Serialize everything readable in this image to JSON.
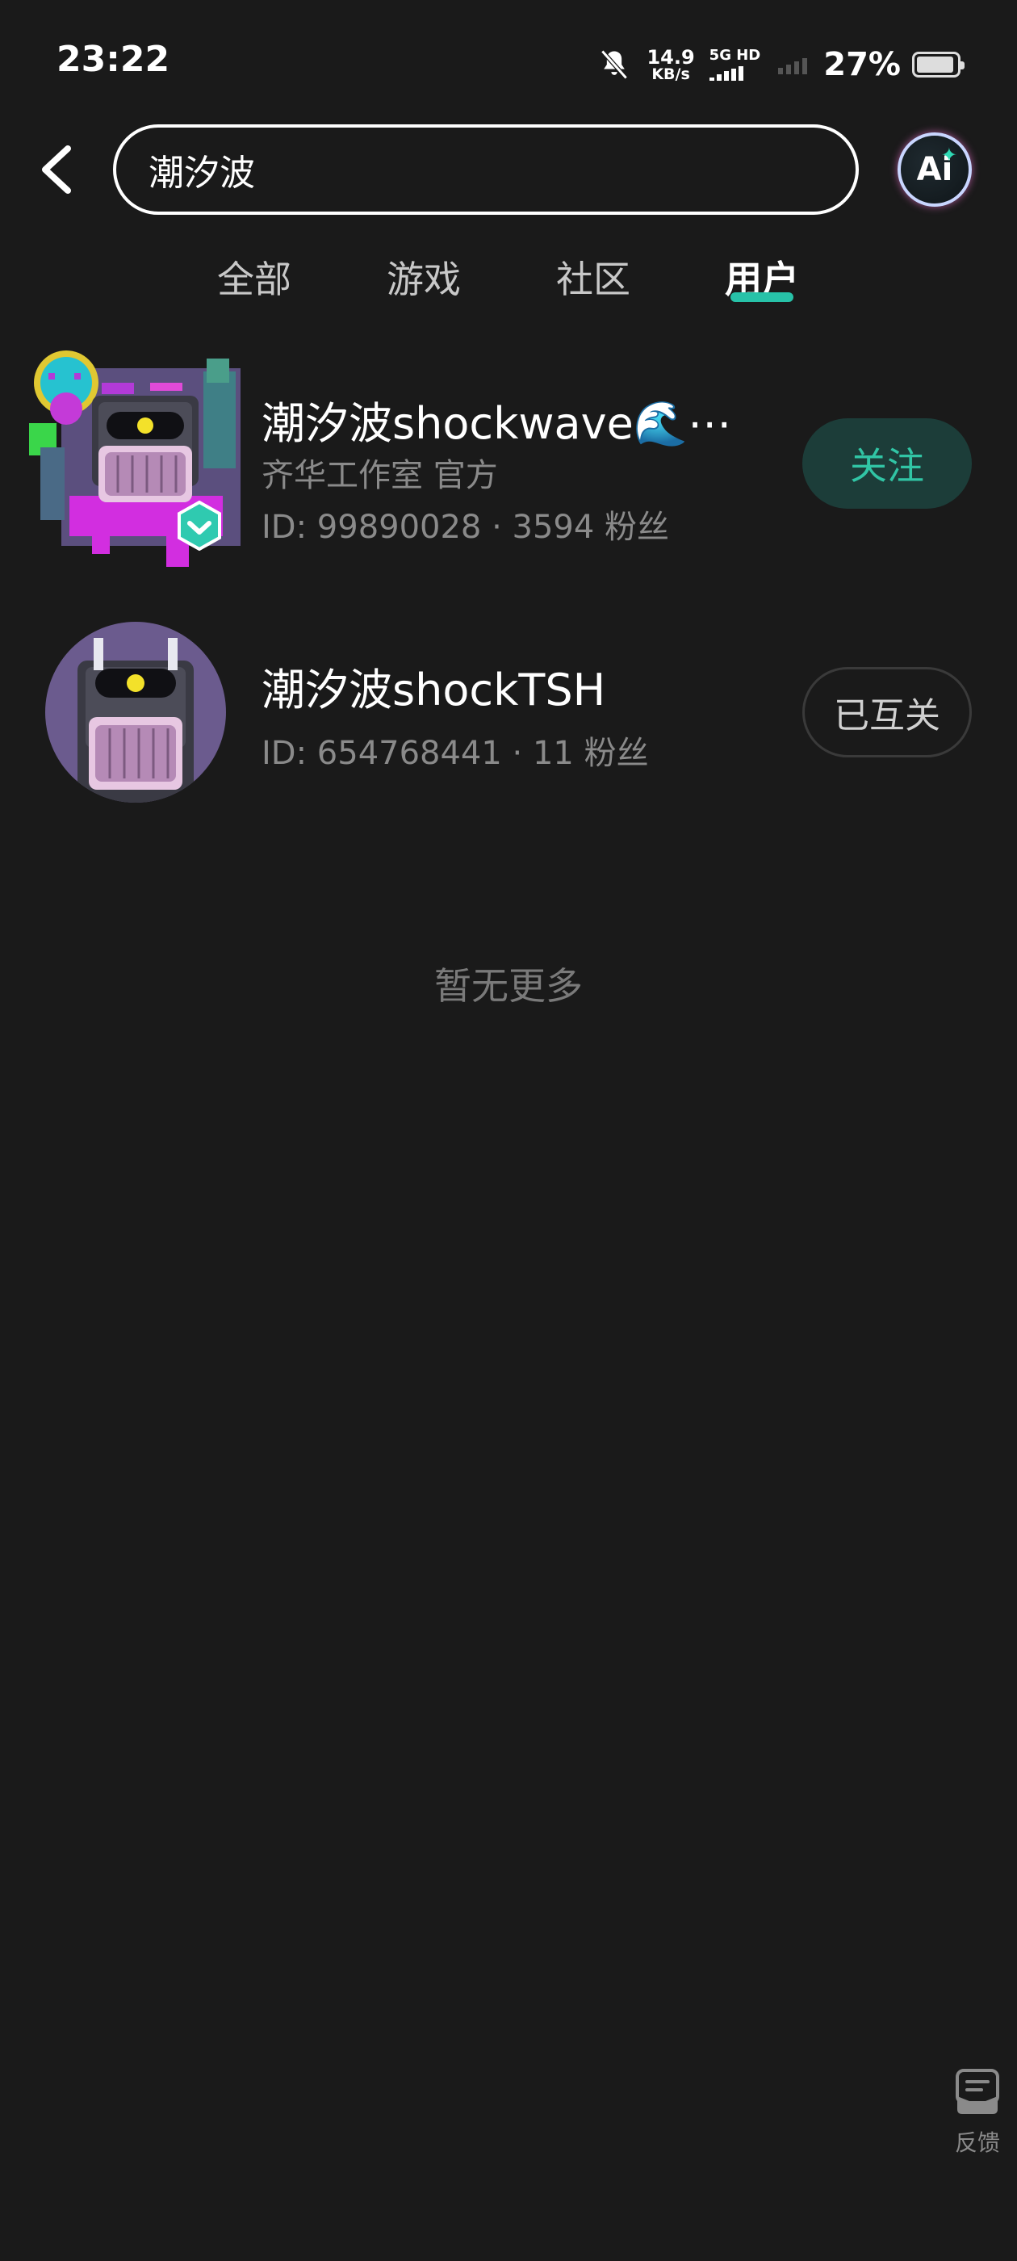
{
  "status_bar": {
    "time": "23:22",
    "net_speed_value": "14.9",
    "net_speed_unit": "KB/s",
    "network_label": "5G HD",
    "battery_percent": "27%",
    "battery_level": 0.27
  },
  "search": {
    "query": "潮汐波"
  },
  "ai_button": {
    "label": "Ai"
  },
  "tabs": [
    {
      "label": "全部",
      "active": false
    },
    {
      "label": "游戏",
      "active": false
    },
    {
      "label": "社区",
      "active": false
    },
    {
      "label": "用户",
      "active": true
    }
  ],
  "results": [
    {
      "name": "潮汐波shockwave🌊⋯",
      "org": "齐华工作室 官方",
      "meta": "ID: 99890028 · 3594 粉丝",
      "action": "关注",
      "verified": true
    },
    {
      "name": "潮汐波shockTSH",
      "meta": "ID: 654768441 · 11 粉丝",
      "action": "已互关",
      "verified": false
    }
  ],
  "no_more": "暂无更多",
  "feedback": {
    "label": "反馈"
  },
  "colors": {
    "background": "#1a1a1a",
    "accent": "#27c2a8",
    "follow_bg": "#1c3d39",
    "follow_text": "#31c5a5"
  }
}
